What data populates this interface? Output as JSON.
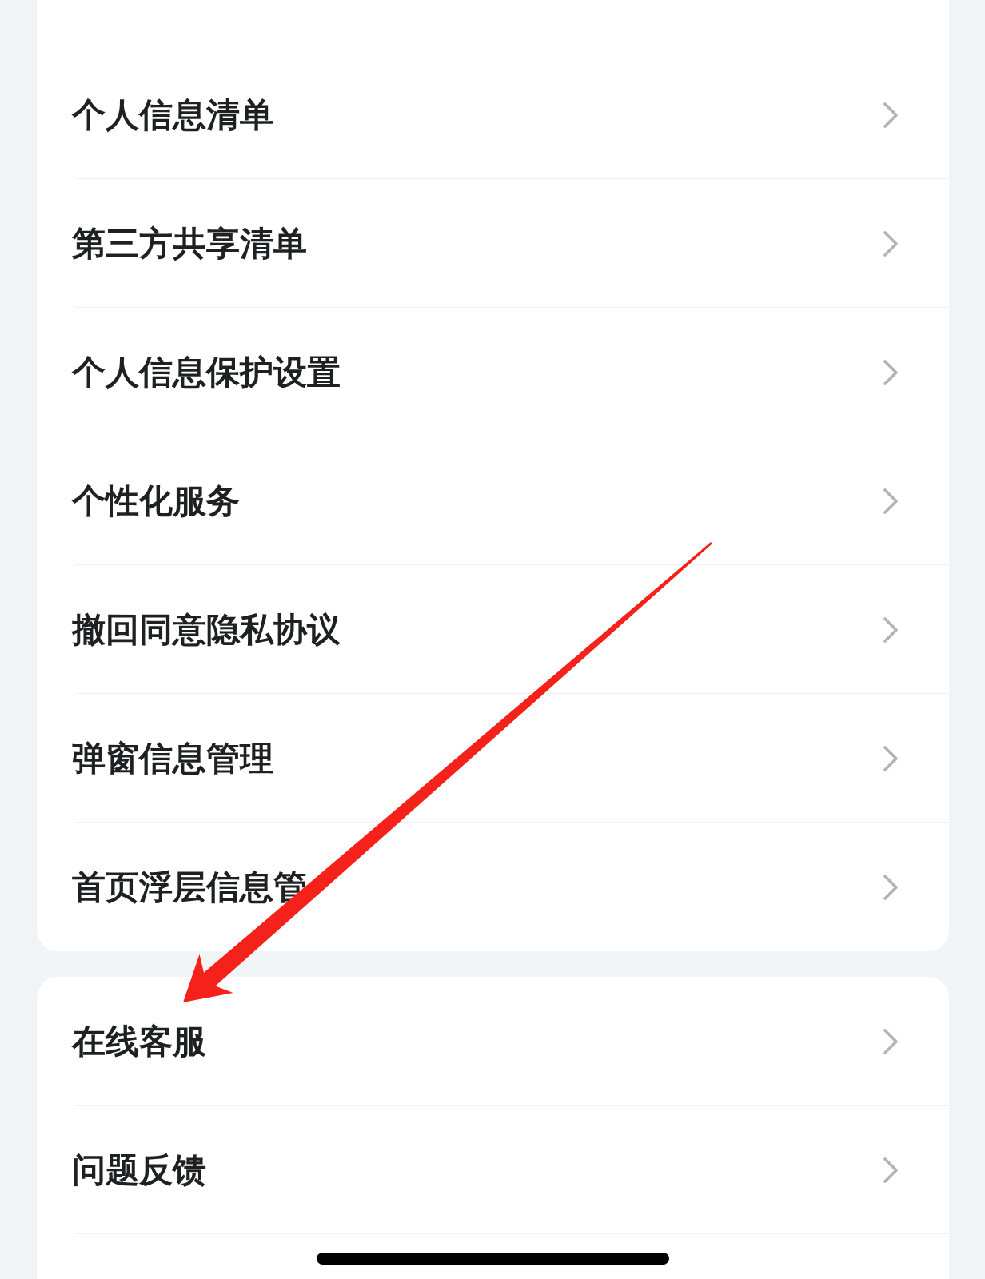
{
  "sections": [
    {
      "items": [
        {
          "label": "个人信息清单"
        },
        {
          "label": "第三方共享清单"
        },
        {
          "label": "个人信息保护设置"
        },
        {
          "label": "个性化服务"
        },
        {
          "label": "撤回同意隐私协议"
        },
        {
          "label": "弹窗信息管理"
        },
        {
          "label": "首页浮层信息管"
        }
      ]
    },
    {
      "items": [
        {
          "label": "在线客服"
        },
        {
          "label": "问题反馈"
        }
      ]
    }
  ],
  "annotation": {
    "kind": "arrow"
  }
}
